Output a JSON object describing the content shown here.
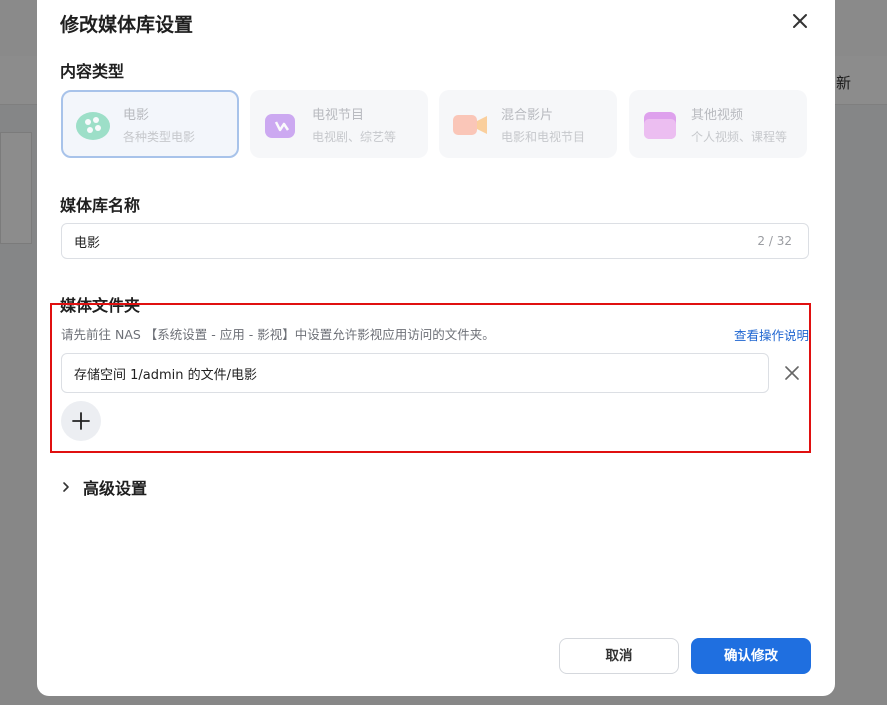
{
  "background": {
    "right_text": "新"
  },
  "modal": {
    "title": "修改媒体库设置",
    "content_type": {
      "label": "内容类型",
      "cards": [
        {
          "title": "电影",
          "subtitle": "各种类型电影",
          "icon": "film-reel-icon",
          "selected": true
        },
        {
          "title": "电视节目",
          "subtitle": "电视剧、综艺等",
          "icon": "tv-icon",
          "selected": false
        },
        {
          "title": "混合影片",
          "subtitle": "电影和电视节目",
          "icon": "video-camera-icon",
          "selected": false
        },
        {
          "title": "其他视频",
          "subtitle": "个人视频、课程等",
          "icon": "folder-icon",
          "selected": false
        }
      ]
    },
    "library_name": {
      "label": "媒体库名称",
      "value": "电影",
      "counter": "2 / 32"
    },
    "media_folder": {
      "label": "媒体文件夹",
      "hint": "请先前往 NAS 【系统设置 - 应用 - 影视】中设置允许影视应用访问的文件夹。",
      "help_link": "查看操作说明",
      "folders": [
        "存储空间 1/admin 的文件/电影"
      ]
    },
    "advanced_label": "高级设置",
    "buttons": {
      "cancel": "取消",
      "confirm": "确认修改"
    }
  },
  "colors": {
    "primary": "#1f6fe0",
    "link": "#1f66d1",
    "highlight_border": "#e01010",
    "selected_card_border": "#a8c3ea"
  }
}
